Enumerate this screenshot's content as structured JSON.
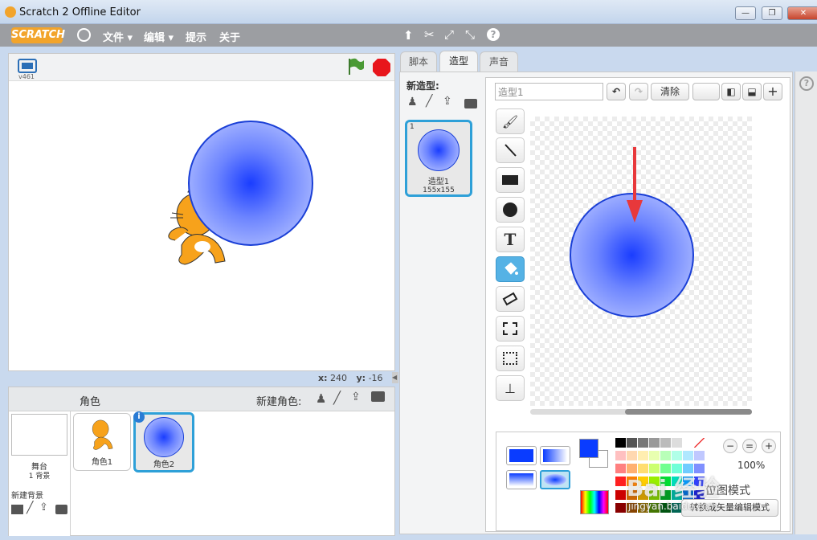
{
  "window": {
    "title": "Scratch 2 Offline Editor"
  },
  "menu": {
    "logo": "SCRATCH",
    "file": "文件",
    "edit": "编辑",
    "tips": "提示",
    "about": "关于"
  },
  "stage": {
    "version": "v461",
    "x_label": "x:",
    "x_value": "240",
    "y_label": "y:",
    "y_value": "-16"
  },
  "sprites": {
    "header": "角色",
    "new_sprite_label": "新建角色:",
    "stage_name": "舞台",
    "stage_backdrops": "1 背景",
    "new_backdrop_label": "新建背景",
    "items": [
      {
        "name": "角色1"
      },
      {
        "name": "角色2"
      }
    ]
  },
  "tabs": [
    "脚本",
    "造型",
    "声音"
  ],
  "costumes": {
    "new_costume_label": "新造型:",
    "items": [
      {
        "index": "1",
        "name": "造型1",
        "size": "155x155"
      }
    ]
  },
  "editor": {
    "costume_name_value": "造型1",
    "clear_label": "清除",
    "zoom_label": "100%",
    "vector_mode_button": "转换成矢量编辑模式",
    "mode_text": "位图模式"
  },
  "watermark": {
    "text": "Bai 经验",
    "url_text": "jingyan.baidu.com"
  },
  "colors": {
    "primary": "#0a3cff",
    "accent_selected": "#2ea0d8",
    "menu_bg": "#9c9ea2",
    "arrow": "#e8383b"
  },
  "palette_colors": [
    [
      "#000000",
      "#555555",
      "#777777",
      "#999999",
      "#bbbbbb",
      "#dddddd",
      "#ffffff",
      "#ffffff"
    ],
    [
      "#ffc0c0",
      "#ffd8b0",
      "#ffeeb0",
      "#e8ffb0",
      "#b8ffb8",
      "#b0ffe8",
      "#b0e8ff",
      "#c0c8ff"
    ],
    [
      "#ff8080",
      "#ffb070",
      "#ffdd70",
      "#ccff70",
      "#70ff90",
      "#70ffd8",
      "#70ccff",
      "#8090ff"
    ],
    [
      "#ff2020",
      "#ff8000",
      "#ffcc00",
      "#99ee00",
      "#00dd33",
      "#00ddbb",
      "#0099ff",
      "#3040ff"
    ],
    [
      "#cc0000",
      "#cc6600",
      "#cc9900",
      "#77bb00",
      "#009922",
      "#00aa99",
      "#0066cc",
      "#1a20cc"
    ],
    [
      "#880000",
      "#884400",
      "#886600",
      "#447700",
      "#005511",
      "#006655",
      "#003388",
      "#110088"
    ]
  ]
}
